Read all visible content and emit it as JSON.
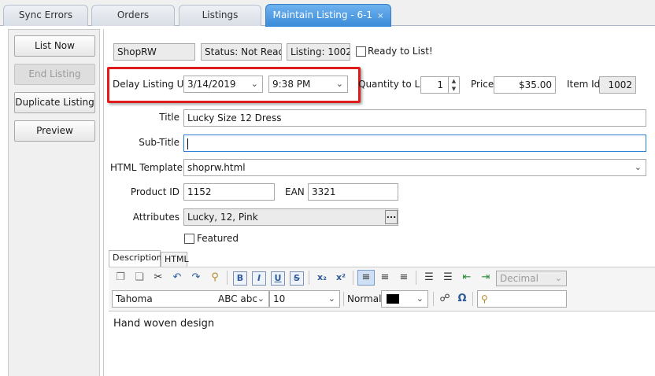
{
  "tabs": [
    {
      "label": "Sync Errors"
    },
    {
      "label": "Orders"
    },
    {
      "label": "Listings"
    },
    {
      "label": "Maintain Listing - 6-1",
      "close": "×"
    }
  ],
  "left_buttons": {
    "list_now": "List Now",
    "end_listing": "End Listing",
    "duplicate_listing": "Duplicate Listing",
    "preview": "Preview"
  },
  "header": {
    "store": "ShopRW",
    "status": "Status: Not Ready",
    "listing": "Listing: 1002",
    "ready_label": "Ready to List!"
  },
  "delay": {
    "label": "Delay Listing Until",
    "date": "3/14/2019",
    "time": "9:38 PM"
  },
  "quantity": {
    "label": "Quantity to List",
    "value": "1"
  },
  "price": {
    "label": "Price",
    "value": "$35.00"
  },
  "item_id": {
    "label": "Item Id",
    "value": "1002"
  },
  "form": {
    "title_label": "Title",
    "title_value": "Lucky Size 12 Dress",
    "subtitle_label": "Sub-Title",
    "subtitle_value": "",
    "template_label": "HTML Template",
    "template_value": "shoprw.html",
    "product_id_label": "Product ID",
    "product_id_value": "1152",
    "ean_label": "EAN",
    "ean_value": "3321",
    "attributes_label": "Attributes",
    "attributes_value": "Lucky, 12, Pink",
    "attributes_button": "...",
    "featured_label": "Featured"
  },
  "editor": {
    "tab_description": "Description",
    "tab_html": "HTML",
    "list_style": "Decimal",
    "font_name": "Tahoma",
    "font_preview": "ABC abc",
    "font_size": "10",
    "paragraph_style": "Normal",
    "text_color": "#000000",
    "content": "Hand woven design"
  },
  "colors": {
    "active_tab": "#3a8bd8",
    "highlight": "#e01b1b",
    "focus_border": "#2a7fd4"
  }
}
